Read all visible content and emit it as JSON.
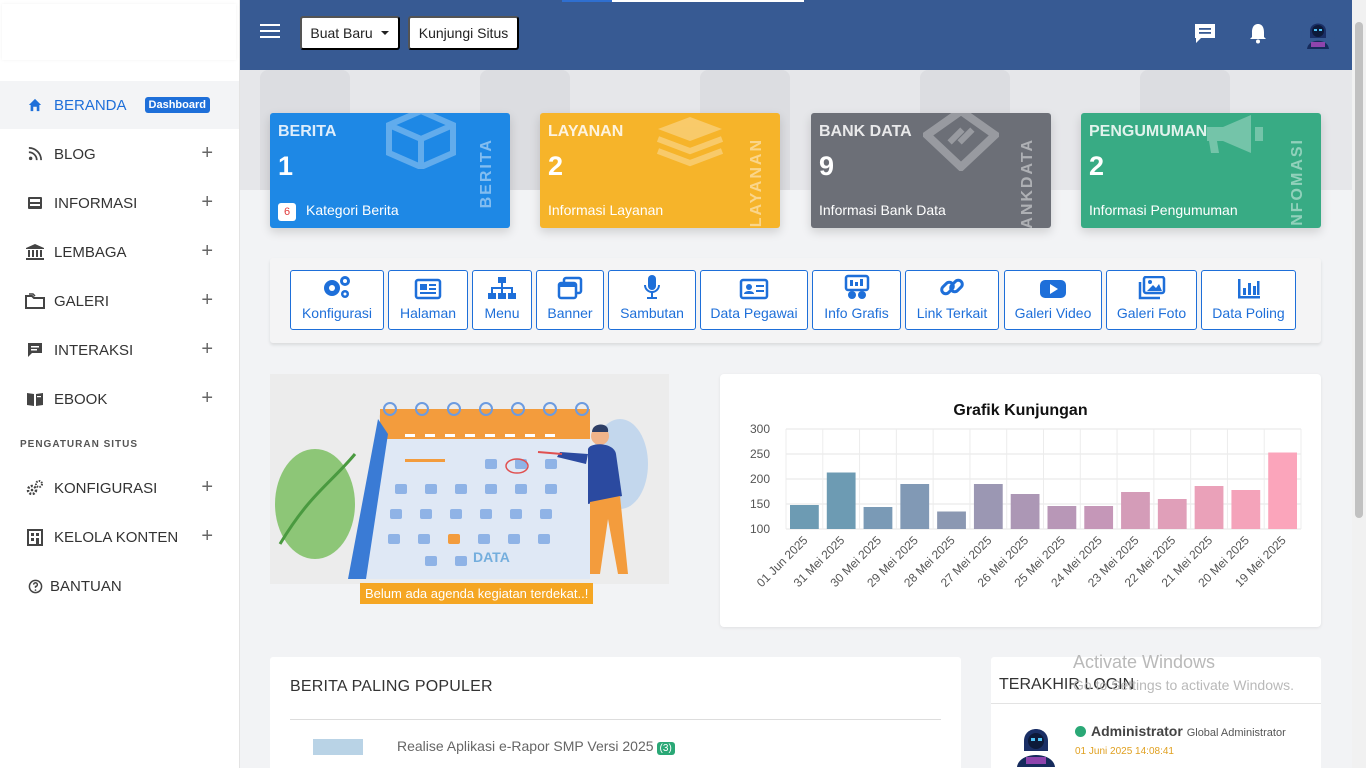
{
  "sidebar": {
    "items": [
      {
        "label": "BERANDA",
        "badge": "Dashboard",
        "icon": "home-icon"
      },
      {
        "label": "BLOG",
        "icon": "rss-icon"
      },
      {
        "label": "INFORMASI",
        "icon": "inbox-icon"
      },
      {
        "label": "LEMBAGA",
        "icon": "institution-icon"
      },
      {
        "label": "GALERI",
        "icon": "folder-icon"
      },
      {
        "label": "INTERAKSI",
        "icon": "chat-icon"
      },
      {
        "label": "EBOOK",
        "icon": "book-icon"
      },
      {
        "label": "KONFIGURASI",
        "icon": "gears-icon"
      },
      {
        "label": "KELOLA KONTEN",
        "icon": "building-icon"
      },
      {
        "label": "BANTUAN",
        "icon": "help-icon"
      }
    ],
    "section_title": "PENGATURAN SITUS",
    "expand_symbol": "+"
  },
  "header": {
    "new_button": "Buat Baru",
    "visit_button": "Kunjungi Situs",
    "icons": [
      "menu-icon",
      "message-icon",
      "bell-icon",
      "user-avatar"
    ]
  },
  "cards": [
    {
      "title": "BERITA",
      "value": "1",
      "badge": "6",
      "footer": "Kategori Berita",
      "side": "BERITA",
      "color": "#1e88e5"
    },
    {
      "title": "LAYANAN",
      "value": "2",
      "footer": "Informasi Layanan",
      "side": "LAYANAN",
      "color": "#f6b42a"
    },
    {
      "title": "BANK DATA",
      "value": "9",
      "footer": "Informasi Bank Data",
      "side": "BANKDATA",
      "color": "#6c6f77"
    },
    {
      "title": "PENGUMUMAN",
      "value": "2",
      "footer": "Informasi Pengumuman",
      "side": "INFOMASI",
      "color": "#38ab84"
    }
  ],
  "quick_menu": [
    {
      "label": "Konfigurasi",
      "icon": "gears-icon"
    },
    {
      "label": "Halaman",
      "icon": "newspaper-icon"
    },
    {
      "label": "Menu",
      "icon": "sitemap-icon"
    },
    {
      "label": "Banner",
      "icon": "windows-icon"
    },
    {
      "label": "Sambutan",
      "icon": "microphone-icon"
    },
    {
      "label": "Data Pegawai",
      "icon": "id-card-icon"
    },
    {
      "label": "Info Grafis",
      "icon": "infographic-icon"
    },
    {
      "label": "Link Terkait",
      "icon": "link-icon"
    },
    {
      "label": "Galeri Video",
      "icon": "youtube-icon"
    },
    {
      "label": "Galeri Foto",
      "icon": "images-icon"
    },
    {
      "label": "Data Poling",
      "icon": "bar-chart-icon"
    }
  ],
  "agenda": {
    "illustration_text": "DATA",
    "message": "Belum ada agenda kegiatan terdekat..!"
  },
  "chart_data": {
    "type": "bar",
    "title": "Grafik Kunjungan",
    "categories": [
      "01 Jun 2025",
      "31 Mei 2025",
      "30 Mei 2025",
      "29 Mei 2025",
      "28 Mei 2025",
      "27 Mei 2025",
      "26 Mei 2025",
      "25 Mei 2025",
      "24 Mei 2025",
      "23 Mei 2025",
      "22 Mei 2025",
      "21 Mei 2025",
      "20 Mei 2025",
      "19 Mei 2025"
    ],
    "values": [
      148,
      213,
      144,
      190,
      135,
      190,
      170,
      146,
      146,
      174,
      160,
      186,
      178,
      253
    ],
    "colors": [
      "#6d9bb3",
      "#6d9bb3",
      "#7a9ab6",
      "#8199b5",
      "#8b98b2",
      "#9b97b3",
      "#ac97b5",
      "#b897b7",
      "#c597b8",
      "#d49cb8",
      "#e09fb9",
      "#eaa1b9",
      "#f4a3ba",
      "#fba5bb"
    ],
    "ylim": [
      100,
      300
    ],
    "yticks": [
      100,
      150,
      200,
      250,
      300
    ],
    "grid": true,
    "legend": "none"
  },
  "popular": {
    "title": "BERITA PALING POPULER",
    "item": "Realise Aplikasi e-Rapor SMP Versi 2025",
    "count": "(3)"
  },
  "last_login": {
    "title": "TERAKHIR LOGIN",
    "name": "Administrator",
    "role": "Global Administrator",
    "time": "01 Juni 2025 14:08:41"
  },
  "watermark": {
    "line1": "Activate Windows",
    "line2": "Go to Settings to activate Windows."
  }
}
